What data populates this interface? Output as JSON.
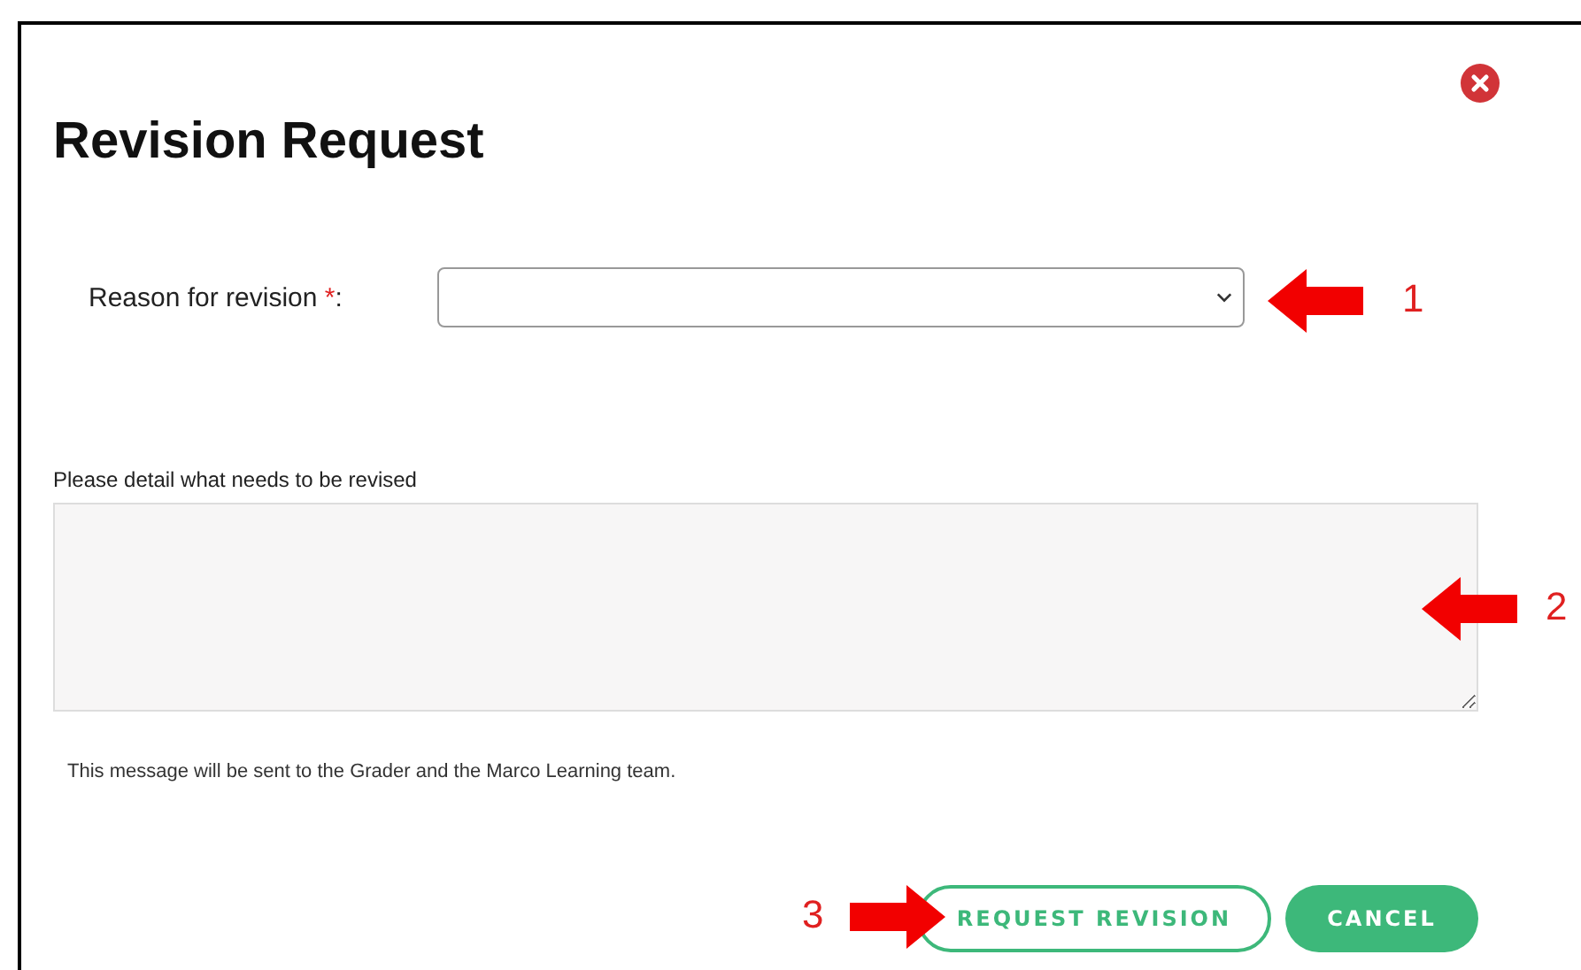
{
  "dialog": {
    "title": "Revision Request",
    "reason": {
      "label": "Reason for revision",
      "required_mark": "*",
      "label_end": ":"
    },
    "details": {
      "label": "Please detail what needs to be revised"
    },
    "note": "This message will be sent to the Grader and the Marco Learning team.",
    "buttons": [
      {
        "label": "REQUEST REVISION",
        "kind": "outline"
      },
      {
        "label": "CANCEL",
        "kind": "filled"
      }
    ]
  },
  "annotations": [
    {
      "number": "1",
      "kind": "left"
    },
    {
      "number": "2",
      "kind": "left"
    },
    {
      "number": "3",
      "kind": "right"
    }
  ]
}
